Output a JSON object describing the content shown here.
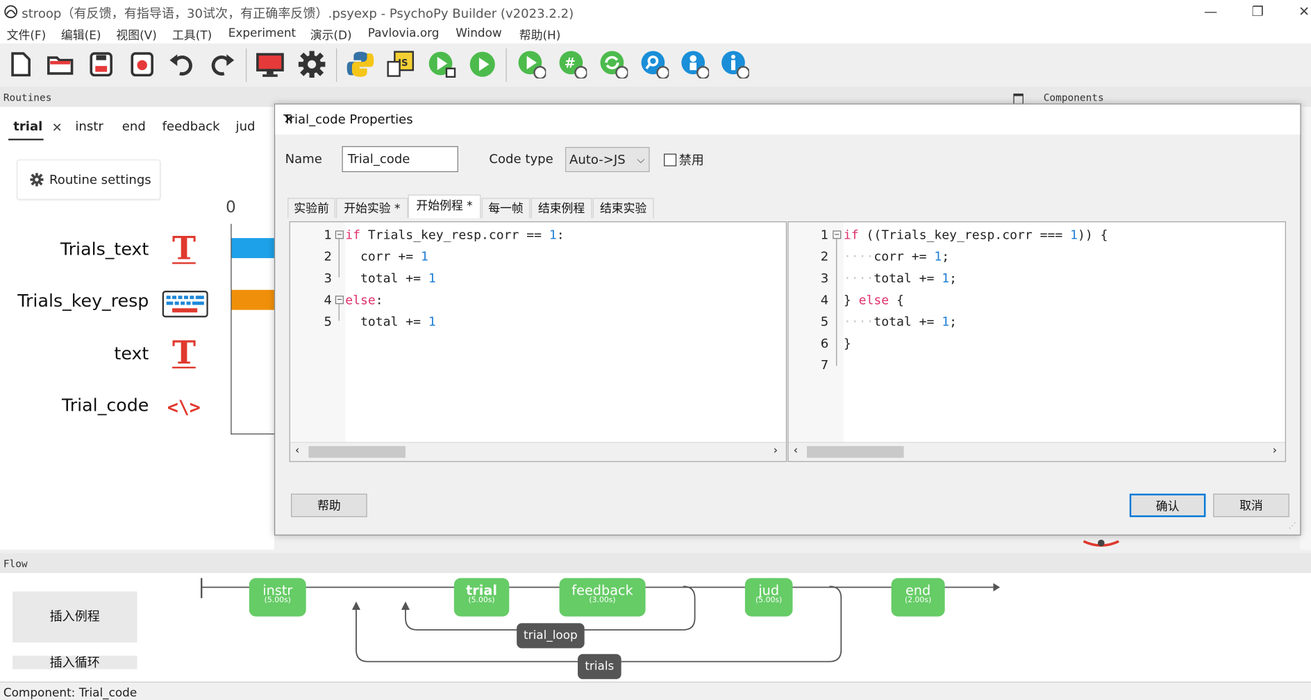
{
  "window": {
    "title": "stroop（有反馈，有指导语，30试次，有正确率反馈）.psyexp - PsychoPy Builder (v2023.2.2)",
    "minimize": "—",
    "restore": "❐",
    "close": "✕"
  },
  "menu": [
    "文件(F)",
    "编辑(E)",
    "视图(V)",
    "工具(T)",
    "Experiment",
    "演示(D)",
    "Pavlovia.org",
    "Window",
    "帮助(H)"
  ],
  "toolbar": {
    "icons": [
      "new-file-icon",
      "open-folder-icon",
      "save-icon",
      "save-as-icon",
      "undo-icon",
      "redo-icon",
      "monitor-icon",
      "settings-gear-icon",
      "python-icon",
      "javascript-icon",
      "run-builder-icon",
      "run-icon",
      "pilot-online-icon",
      "sync-icon",
      "recycle-icon",
      "search-icon",
      "user-icon",
      "info-icon"
    ]
  },
  "routines_panel": {
    "header": "Routines",
    "tabs": [
      "trial",
      "instr",
      "end",
      "feedback",
      "jud"
    ],
    "active_tab": "trial",
    "routine_settings_label": "Routine settings",
    "timeline_start": "0",
    "components": [
      {
        "label": "Trials_text",
        "icon": "text-T-icon",
        "bar_color": "#1da1e8"
      },
      {
        "label": "Trials_key_resp",
        "icon": "keyboard-icon",
        "bar_color": "#f0900a"
      },
      {
        "label": "text",
        "icon": "text-T-icon",
        "bar_color": ""
      },
      {
        "label": "Trial_code",
        "icon": "code-icon",
        "bar_color": ""
      }
    ]
  },
  "components_panel": {
    "header": "Components"
  },
  "dialog": {
    "title": "Trial_code Properties",
    "name_label": "Name",
    "name_value": "Trial_code",
    "code_type_label": "Code type",
    "code_type_value": "Auto->JS",
    "disabled_label": "禁用",
    "tabs": [
      "实验前",
      "开始实验 *",
      "开始例程 *",
      "每一帧",
      "结束例程",
      "结束实验"
    ],
    "active_tab": "开始例程 *",
    "python_code": [
      "if Trials_key_resp.corr == 1:",
      "    corr += 1",
      "    total += 1",
      "else:",
      "    total += 1"
    ],
    "js_code": [
      "if ((Trials_key_resp.corr === 1)) {",
      "    corr += 1;",
      "    total += 1;",
      "} else {",
      "    total += 1;",
      "}",
      ""
    ],
    "help_button": "帮助",
    "ok_button": "确认",
    "cancel_button": "取消"
  },
  "flow": {
    "header": "Flow",
    "insert_routine": "插入例程",
    "insert_loop": "插入循环",
    "nodes": [
      {
        "name": "instr",
        "duration": "(5.00s)",
        "bold": false
      },
      {
        "name": "trial",
        "duration": "(5.00s)",
        "bold": true
      },
      {
        "name": "feedback",
        "duration": "(3.00s)",
        "bold": false
      },
      {
        "name": "jud",
        "duration": "(5.00s)",
        "bold": false
      },
      {
        "name": "end",
        "duration": "(2.00s)",
        "bold": false
      }
    ],
    "loops": [
      "trial_loop",
      "trials"
    ]
  },
  "status_bar": "Component: Trial_code"
}
